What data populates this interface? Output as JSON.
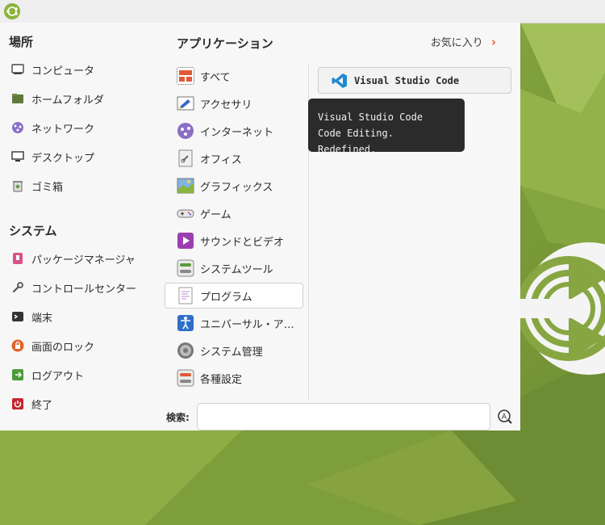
{
  "places": {
    "title": "場所",
    "items": [
      "コンピュータ",
      "ホームフォルダ",
      "ネットワーク",
      "デスクトップ",
      "ゴミ箱"
    ]
  },
  "system": {
    "title": "システム",
    "items": [
      "パッケージマネージャ",
      "コントロールセンター",
      "端末",
      "画面のロック",
      "ログアウト",
      "終了"
    ]
  },
  "applications": {
    "title": "アプリケーション",
    "favorites_label": "お気に入り",
    "categories": [
      "すべて",
      "アクセサリ",
      "インターネット",
      "オフィス",
      "グラフィックス",
      "ゲーム",
      "サウンドとビデオ",
      "システムツール",
      "プログラム",
      "ユニバーサル・ア…",
      "システム管理",
      "各種設定"
    ],
    "selected": "プログラム"
  },
  "app_list": [
    {
      "name": "Visual Studio Code",
      "icon": "vscode-icon"
    }
  ],
  "tooltip": {
    "line1": "Visual Studio Code",
    "line2": "Code Editing. Redefined."
  },
  "search": {
    "label": "検索:",
    "value": ""
  },
  "colors": {
    "accent": "#e2622a",
    "desktop": "#8aab42",
    "menu_bg": "#f7f7f7"
  }
}
